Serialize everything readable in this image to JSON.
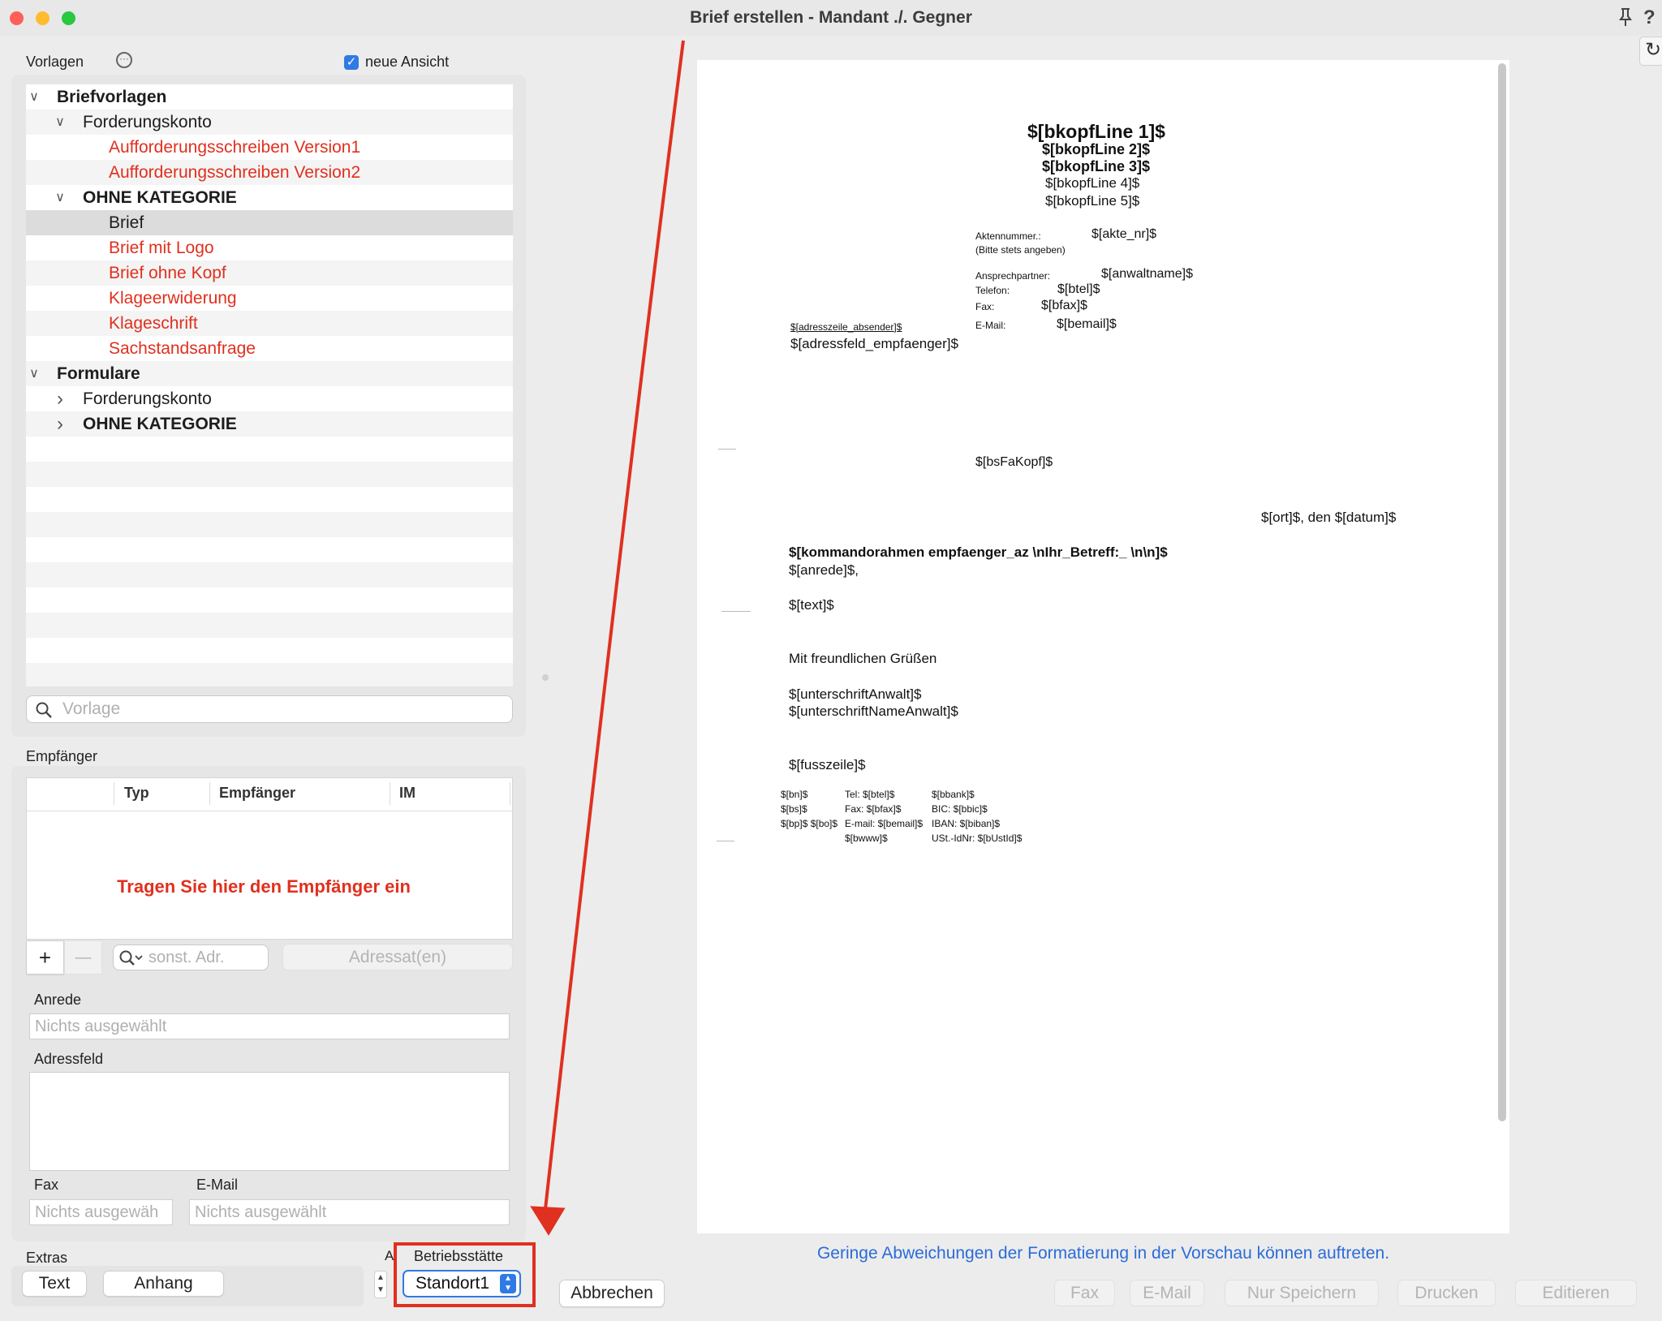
{
  "window": {
    "title": "Brief erstellen - Mandant ./. Gegner",
    "help": "?"
  },
  "colors": {
    "close": "#ff5f57",
    "minimize": "#febc2e",
    "zoom": "#28c840",
    "red_text": "#e0301e",
    "link": "#2b6cd9",
    "annotation": "#e03020"
  },
  "vorlagen": {
    "label": "Vorlagen",
    "checkbox_label": "neue Ansicht",
    "checkbox_checked": true,
    "search_placeholder": "Vorlage",
    "tree": [
      {
        "label": "Briefvorlagen",
        "level": 0,
        "expanded": true,
        "bold": true,
        "red": false
      },
      {
        "label": "Forderungskonto",
        "level": 1,
        "expanded": true,
        "bold": false,
        "red": false
      },
      {
        "label": "Aufforderungsschreiben Version1",
        "level": 2,
        "bold": false,
        "red": true
      },
      {
        "label": "Aufforderungsschreiben Version2",
        "level": 2,
        "bold": false,
        "red": true
      },
      {
        "label": "OHNE KATEGORIE",
        "level": 1,
        "expanded": true,
        "bold": true,
        "red": false
      },
      {
        "label": "Brief",
        "level": 2,
        "bold": false,
        "red": false,
        "selected": true
      },
      {
        "label": "Brief mit Logo",
        "level": 2,
        "bold": false,
        "red": true
      },
      {
        "label": "Brief ohne Kopf",
        "level": 2,
        "bold": false,
        "red": true
      },
      {
        "label": "Klageerwiderung",
        "level": 2,
        "bold": false,
        "red": true
      },
      {
        "label": "Klageschrift",
        "level": 2,
        "bold": false,
        "red": true
      },
      {
        "label": "Sachstandsanfrage",
        "level": 2,
        "bold": false,
        "red": true
      },
      {
        "label": "Formulare",
        "level": 0,
        "expanded": true,
        "bold": true,
        "red": false
      },
      {
        "label": "Forderungskonto",
        "level": 1,
        "expanded": false,
        "bold": false,
        "red": false
      },
      {
        "label": "OHNE KATEGORIE",
        "level": 1,
        "expanded": false,
        "bold": true,
        "red": false
      }
    ]
  },
  "empfaenger": {
    "label": "Empfänger",
    "columns": [
      "Typ",
      "Empfänger",
      "IM"
    ],
    "empty_hint": "Tragen Sie hier den Empfänger ein",
    "add_label": "+",
    "remove_label": "—",
    "search_placeholder": "sonst. Adr.",
    "adressat_label": "Adressat(en)",
    "anrede_label": "Anrede",
    "anrede_placeholder": "Nichts ausgewählt",
    "adressfeld_label": "Adressfeld",
    "fax_label": "Fax",
    "fax_placeholder": "Nichts ausgewäh",
    "email_label": "E-Mail",
    "email_placeholder": "Nichts ausgewählt"
  },
  "bottom": {
    "extras_label": "Extras",
    "text_button": "Text",
    "anhang_button": "Anhang",
    "truncated_label": "A",
    "betrieb_label": "Betriebsstätte",
    "betrieb_value": "Standort1",
    "abbrechen": "Abbrechen",
    "actions": [
      "Fax",
      "E-Mail",
      "Nur Speichern",
      "Drucken",
      "Editieren"
    ]
  },
  "preview": {
    "head": [
      "$[bkopfLine 1]$",
      "$[bkopfLine 2]$",
      "$[bkopfLine 3]$",
      "$[bkopfLine 4]$",
      "$[bkopfLine 5]$"
    ],
    "akten_label": "Aktennummer.:",
    "akten_hint": "(Bitte stets angeben)",
    "akten_value": "$[akte_nr]$",
    "ansprech_label": "Ansprechpartner:",
    "ansprech_value": "$[anwaltname]$",
    "telefon_label": "Telefon:",
    "telefon_value": "$[btel]$",
    "fax_label": "Fax:",
    "fax_value": "$[bfax]$",
    "email_label": "E-Mail:",
    "email_value": "$[bemail]$",
    "absender": "$[adresszeile_absender]$",
    "empfaenger": "$[adressfeld_empfaenger]$",
    "bsfakopf": "$[bsFaKopf]$",
    "ortdatum": "$[ort]$, den $[datum]$",
    "kommando": "$[kommandorahmen empfaenger_az \\nIhr_Betreff:_ \\n\\n]$",
    "anrede": "$[anrede]$,",
    "text": "$[text]$",
    "gruss": "Mit freundlichen Grüßen",
    "unterschrift1": "$[unterschriftAnwalt]$",
    "unterschrift2": "$[unterschriftNameAnwalt]$",
    "fusszeile": "$[fusszeile]$",
    "footer_col1": [
      "$[bn]$",
      "$[bs]$",
      "$[bp]$ $[bo]$"
    ],
    "footer_col2": [
      "Tel: $[btel]$",
      "Fax: $[bfax]$",
      "E-mail: $[bemail]$",
      "$[bwww]$"
    ],
    "footer_col3": [
      "$[bbank]$",
      "BIC: $[bbic]$",
      "IBAN: $[biban]$",
      "USt.-IdNr: $[bUstId]$"
    ],
    "notice": "Geringe Abweichungen der Formatierung in der Vorschau können auftreten."
  }
}
